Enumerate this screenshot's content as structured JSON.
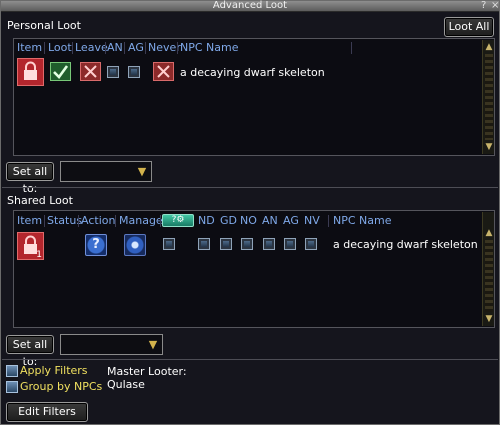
{
  "window": {
    "title": "Advanced Loot",
    "controls": [
      "?",
      "×"
    ]
  },
  "personal": {
    "title": "Personal Loot",
    "loot_all_label": "Loot All",
    "headers": [
      "Item",
      "Loot",
      "Leave",
      "AN",
      "AG",
      "Never",
      "NPC Name"
    ],
    "row": {
      "npc_name": "a decaying dwarf skeleton"
    },
    "set_all_label": "Set all to:"
  },
  "shared": {
    "title": "Shared Loot",
    "headers": [
      "Item",
      "Status",
      "Action",
      "Manage",
      "ND",
      "GD",
      "NO",
      "AN",
      "AG",
      "NV",
      "NPC Name"
    ],
    "row": {
      "item_count": "1",
      "npc_name": "a decaying dwarf skeleton"
    },
    "set_all_label": "Set all to:"
  },
  "footer": {
    "apply_filters_label": "Apply Filters",
    "group_by_npcs_label": "Group by NPCs",
    "master_looter_label": "Master Looter:",
    "master_looter_name": "Qulase",
    "edit_filters_label": "Edit Filters"
  },
  "icons": {
    "item": "lock-icon",
    "loot": "checkmark-icon",
    "leave": "x-icon",
    "never": "x-icon",
    "action": "question-icon",
    "manage": "gear-icon",
    "dropdown": "chevron-down-icon"
  },
  "colors": {
    "header_text": "#7fa8e8",
    "filter_text": "#f0e060",
    "accent_teal": "#43c7a5"
  }
}
